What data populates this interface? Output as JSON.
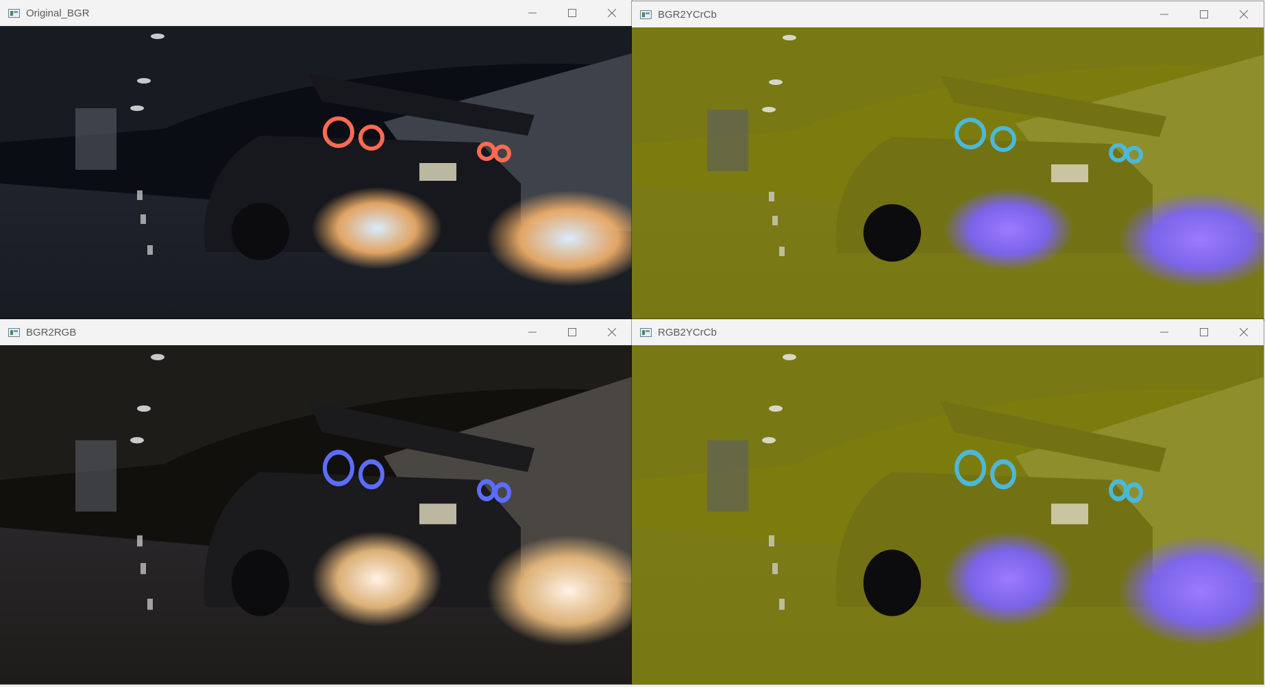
{
  "windows": [
    {
      "title": "Original_BGR",
      "variant": "original"
    },
    {
      "title": "BGR2YCrCb",
      "variant": "ycrcb"
    },
    {
      "title": "BGR2RGB",
      "variant": "rgb"
    },
    {
      "title": "RGB2YCrCb",
      "variant": "ycrcb"
    }
  ],
  "icons": {
    "app": "opencv-window-icon",
    "minimize": "minimize-icon",
    "maximize": "maximize-icon",
    "close": "close-icon"
  },
  "palettes": {
    "original": {
      "sky": "#0a0d14",
      "tunnel": "#171b22",
      "wall": "#3e434b",
      "road": "#1f242c",
      "car": "#16181d",
      "light": "#ff6a52",
      "flameOuter": "#f7b36b",
      "flameInner": "#d8ecff"
    },
    "rgb": {
      "sky": "#12100c",
      "tunnel": "#1e1c19",
      "wall": "#4a4743",
      "road": "#29262a",
      "car": "#1b1a1d",
      "light": "#5b6dff",
      "flameOuter": "#f0c080",
      "flameInner": "#fff3e6"
    },
    "ycrcb": {
      "sky": "#7c7c0e",
      "tunnel": "#787814",
      "wall": "#8e8e2c",
      "road": "#7a7a16",
      "car": "#727214",
      "light": "#4bb8d8",
      "flameOuter": "#7b62ff",
      "flameInner": "#9e7bff"
    }
  }
}
